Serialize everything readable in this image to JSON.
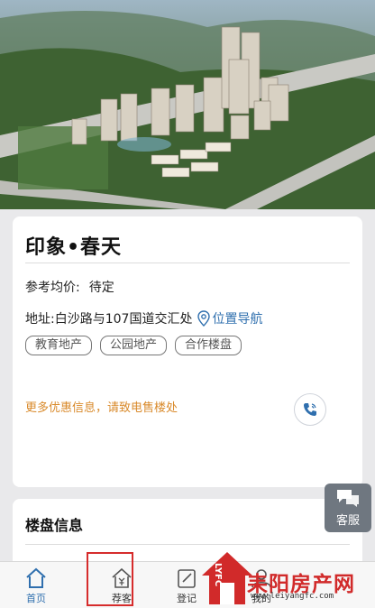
{
  "hero": {
    "image": "aerial-rendering-of-residential-complex"
  },
  "project": {
    "name": "印象•春天",
    "price_label": "参考均价:",
    "price_value": "待定",
    "address": "地址:白沙路与107国道交汇处",
    "nav_label": "位置导航",
    "tags": [
      "教育地产",
      "公园地产",
      "合作楼盘"
    ],
    "promo": "更多优惠信息，请致电售楼处"
  },
  "section": {
    "title": "楼盘信息"
  },
  "service": {
    "label": "客服"
  },
  "tabbar": {
    "home": "首页",
    "recommend": "荐客",
    "register": "登记",
    "mine": "我的"
  },
  "watermark": {
    "brand": "耒阳房产网",
    "url": "www.leiyangfc.com",
    "side": "LYFC"
  },
  "colors": {
    "link": "#2f6fae",
    "promo": "#d98a2b",
    "highlight": "#d62c2c",
    "brand": "#d12a2a"
  }
}
